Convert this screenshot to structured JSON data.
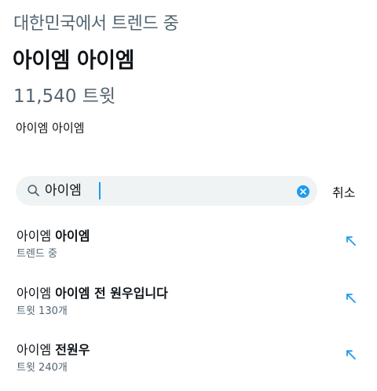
{
  "trend": {
    "context": "대한민국에서 트렌드 중",
    "title": "아이엠 아이엠",
    "tweet_count": "11,540 트윗",
    "query": "아이엠 아이엠"
  },
  "search": {
    "value": "아이엠",
    "icon": "search-icon",
    "clear_icon": "clear-x-icon",
    "cancel_label": "취소"
  },
  "suggestions": [
    {
      "typed": "아이엠 ",
      "rest": "아이엠",
      "sub": "트렌드 중",
      "icon": "arrow-up-left-icon"
    },
    {
      "typed": "아이엠 ",
      "rest": "아이엠 전 원우입니다",
      "sub": "트윗 130개",
      "icon": "arrow-up-left-icon"
    },
    {
      "typed": "아이엠 ",
      "rest": "전원우",
      "sub": "트윗 240개",
      "icon": "arrow-up-left-icon"
    }
  ],
  "colors": {
    "accent": "#1d9bf0",
    "text_primary": "#0f1419",
    "text_secondary": "#536471",
    "search_background": "#eff3f4"
  }
}
